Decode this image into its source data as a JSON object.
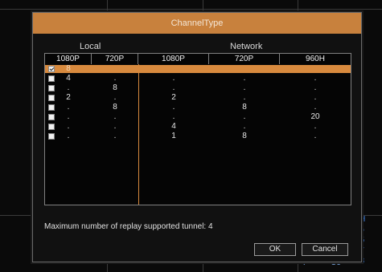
{
  "dialog": {
    "title": "ChannelType",
    "group_local": "Local",
    "group_network": "Network",
    "columns": [
      "1080P",
      "720P",
      "1080P",
      "720P",
      "960H"
    ],
    "rows": [
      {
        "checked": true,
        "selected": true,
        "values": [
          "8",
          "",
          "",
          "",
          ""
        ]
      },
      {
        "checked": false,
        "selected": false,
        "values": [
          "4",
          ".",
          ".",
          ".",
          "."
        ]
      },
      {
        "checked": false,
        "selected": false,
        "values": [
          ".",
          "8",
          ".",
          ".",
          "."
        ]
      },
      {
        "checked": false,
        "selected": false,
        "values": [
          "2",
          ".",
          "2",
          ".",
          "."
        ]
      },
      {
        "checked": false,
        "selected": false,
        "values": [
          ".",
          "8",
          ".",
          "8",
          "."
        ]
      },
      {
        "checked": false,
        "selected": false,
        "values": [
          ".",
          ".",
          ".",
          ".",
          "20"
        ]
      },
      {
        "checked": false,
        "selected": false,
        "values": [
          ".",
          ".",
          "4",
          ".",
          "."
        ]
      },
      {
        "checked": false,
        "selected": false,
        "values": [
          ".",
          ".",
          "1",
          "8",
          "."
        ]
      }
    ],
    "message": "Maximum number of replay supported tunnel: 4",
    "ok_label": "OK",
    "cancel_label": "Cancel"
  },
  "background": {
    "side_labels": [
      "H",
      "5",
      "6",
      "7",
      "8"
    ],
    "bottom_labels": [
      "4",
      "39"
    ]
  }
}
